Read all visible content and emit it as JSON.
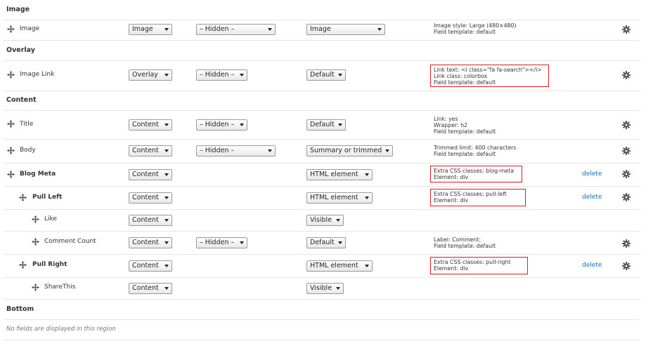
{
  "regions": {
    "image": "Image",
    "overlay": "Overlay",
    "content": "Content",
    "bottom": "Bottom"
  },
  "bottom_empty": "No fields are displayed in this region",
  "rows": {
    "image": {
      "label": "Image",
      "region": "Image",
      "label_display": "– Hidden –",
      "formatter": "Image",
      "summary": [
        "Image style: Large (480×480)",
        "Field template: default"
      ]
    },
    "image_link": {
      "label": "Image Link",
      "region": "Overlay",
      "label_display": "– Hidden –",
      "formatter": "Default",
      "summary": [
        "Link text: <i class=\"fa fa-search\"></i>",
        "Link class: colorbox",
        "Field template: default"
      ]
    },
    "title": {
      "label": "Title",
      "region": "Content",
      "label_display": "– Hidden –",
      "formatter": "Default",
      "summary": [
        "Link: yes",
        "Wrapper: h2",
        "Field template: default"
      ]
    },
    "body": {
      "label": "Body",
      "region": "Content",
      "label_display": "– Hidden –",
      "formatter": "Summary or trimmed",
      "summary": [
        "Trimmed limit: 400 characters",
        "Field template: default"
      ]
    },
    "blog_meta": {
      "label": "Blog Meta",
      "region": "Content",
      "formatter": "HTML element",
      "summary": [
        "Extra CSS classes: blog-meta",
        "Element: div"
      ],
      "delete": "delete"
    },
    "pull_left": {
      "label": "Pull Left",
      "region": "Content",
      "formatter": "HTML element",
      "summary": [
        "Extra CSS classes: pull-left",
        "Element: div"
      ],
      "delete": "delete"
    },
    "like": {
      "label": "Like",
      "region": "Content",
      "formatter": "Visible"
    },
    "comment_count": {
      "label": "Comment Count",
      "region": "Content",
      "label_display": "– Hidden –",
      "formatter": "Default",
      "summary": [
        "Label: Comment:",
        "Field template: default"
      ]
    },
    "pull_right": {
      "label": "Pull Right",
      "region": "Content",
      "formatter": "HTML element",
      "summary": [
        "Extra CSS classes: pull-right",
        "Element: div"
      ],
      "delete": "delete"
    },
    "sharethis": {
      "label": "ShareThis",
      "region": "Content",
      "formatter": "Visible"
    }
  },
  "colors": {
    "highlight_box": "#d0222a",
    "link": "#1a6fb3"
  },
  "icons": {
    "drag": "drag-handle-icon",
    "settings": "gear-icon",
    "dropdown": "chevron-down-icon"
  }
}
